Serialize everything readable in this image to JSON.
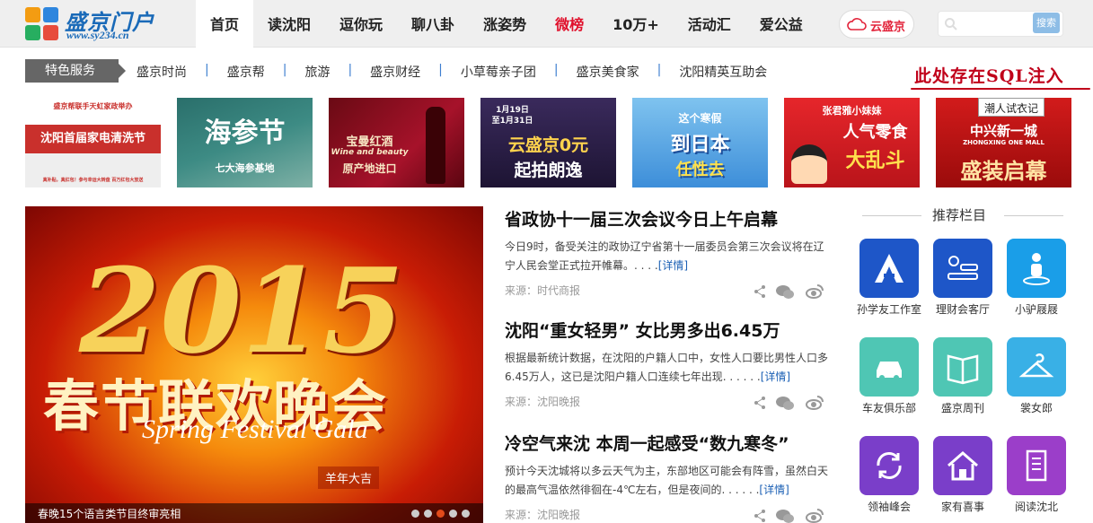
{
  "logo": {
    "name": "盛京门户",
    "url": "www.sy234.cn"
  },
  "menu": [
    {
      "label": "首页",
      "active": true
    },
    {
      "label": "读沈阳"
    },
    {
      "label": "逗你玩"
    },
    {
      "label": "聊八卦"
    },
    {
      "label": "涨姿势"
    },
    {
      "label": "微榜",
      "hot": true
    },
    {
      "label": "10万+"
    },
    {
      "label": "活动汇"
    },
    {
      "label": "爱公益"
    }
  ],
  "cloud": {
    "label": "云盛京"
  },
  "search": {
    "placeholder": "",
    "button": "搜索"
  },
  "subnav": {
    "tag": "特色服务",
    "links": [
      "盛京时尚",
      "盛京帮",
      "旅游",
      "盛京财经",
      "小草莓亲子团",
      "盛京美食家",
      "沈阳精英互助会"
    ]
  },
  "annotation": {
    "text": "此处存在SQL注入",
    "color": "#c0001a"
  },
  "tooltip": "潮人试衣记",
  "banners": [
    {
      "lines": [
        "盛京帮联手天虹家政举办",
        "沈阳首届家电清洗节",
        "真补贴，真红包！参与幸运大转盘 百万红包大放送"
      ]
    },
    {
      "lines": [
        "海参节",
        "七大海参基地"
      ]
    },
    {
      "lines": [
        "宝曼红酒",
        "Wine and beauty",
        "原产地进口"
      ]
    },
    {
      "lines": [
        "1月19日",
        "至1月31日",
        "云盛京0元",
        "起拍朗逸"
      ]
    },
    {
      "lines": [
        "这个寒假",
        "到日本",
        "任性去"
      ]
    },
    {
      "lines": [
        "张君雅小妹妹",
        "人气零食",
        "大乱斗"
      ]
    },
    {
      "lines": [
        "中兴新一城",
        "ZHONGXING ONE MALL",
        "盛装启幕"
      ]
    }
  ],
  "hero": {
    "year": "2015",
    "title": "春节联欢晚会",
    "subtitle": "Spring Festival Gala",
    "tag": "羊年大吉",
    "caption": "春晚15个语言类节目终审亮相",
    "dots": 5,
    "active_dot": 2
  },
  "news": [
    {
      "title": "省政协十一届三次会议今日上午启幕",
      "summary": "今日9时，备受关注的政协辽宁省第十一届委员会第三次会议将在辽宁人民会堂正式拉开帷幕。. . . .",
      "more": "[详情]",
      "source": "来源：时代商报"
    },
    {
      "title": "沈阳“重女轻男” 女比男多出6.45万",
      "summary": "根据最新统计数据，在沈阳的户籍人口中，女性人口要比男性人口多6.45万人，这已是沈阳户籍人口连续七年出现. . . . . .",
      "more": "[详情]",
      "source": "来源：沈阳晚报"
    },
    {
      "title": "冷空气来沈 本周一起感受“数九寒冬”",
      "summary": "预计今天沈城将以多云天气为主，东部地区可能会有阵雪，虽然白天的最高气温依然徘徊在-4℃左右，但是夜间的. . . . . .",
      "more": "[详情]",
      "source": "来源：沈阳晚报"
    }
  ],
  "recommend": {
    "title": "推荐栏目",
    "items": [
      {
        "label": "孙学友工作室",
        "icon": "a-logo-icon",
        "color": "#1e56c8"
      },
      {
        "label": "理财会客厅",
        "icon": "finance-icon",
        "color": "#1e56c8"
      },
      {
        "label": "小驴屐屐",
        "icon": "person-icon",
        "color": "#1a9ee8"
      },
      {
        "label": "车友俱乐部",
        "icon": "car-icon",
        "color": "#4fc6b4"
      },
      {
        "label": "盛京周刊",
        "icon": "book-icon",
        "color": "#4fc6b4"
      },
      {
        "label": "裳女郎",
        "icon": "hanger-icon",
        "color": "#39b0e6"
      },
      {
        "label": "领袖峰会",
        "icon": "refresh-icon",
        "color": "#7a3ec9"
      },
      {
        "label": "家有喜事",
        "icon": "home-icon",
        "color": "#7a3ec9"
      },
      {
        "label": "阅读沈北",
        "icon": "reader-icon",
        "color": "#9b3ec9"
      }
    ]
  }
}
